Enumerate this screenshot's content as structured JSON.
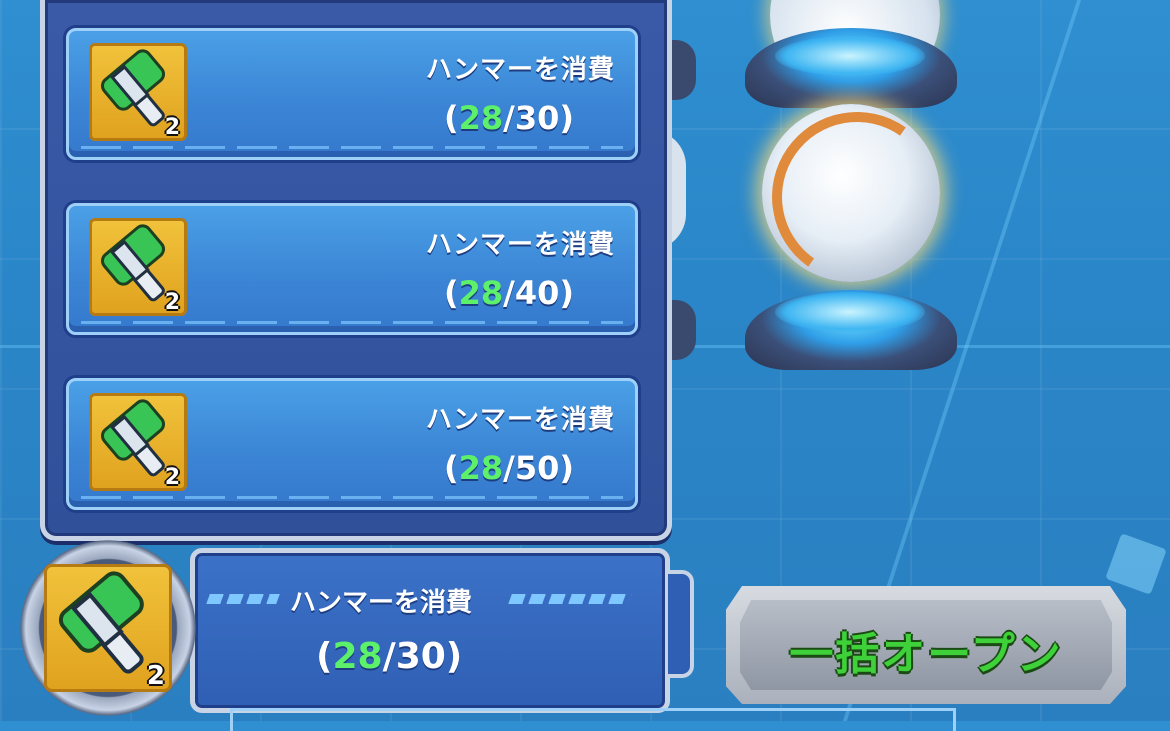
{
  "panel": {
    "slots": [
      {
        "label": "ハンマーを消費",
        "current": "28",
        "required": "/30)",
        "open": "(",
        "badge": "2"
      },
      {
        "label": "ハンマーを消費",
        "current": "28",
        "required": "/40)",
        "open": "(",
        "badge": "2"
      },
      {
        "label": "ハンマーを消費",
        "current": "28",
        "required": "/50)",
        "open": "(",
        "badge": "2"
      }
    ]
  },
  "selector": {
    "label": "ハンマーを消費",
    "open": "(",
    "current": "28",
    "required": "/30)",
    "badge": "2"
  },
  "bulk_open_button": {
    "label": "一括オープン"
  },
  "icons": {
    "item": "green-hammer-icon"
  },
  "colors": {
    "current_count": "#5df06a",
    "button_text": "#3fd13a",
    "background": "#2a86c8"
  }
}
